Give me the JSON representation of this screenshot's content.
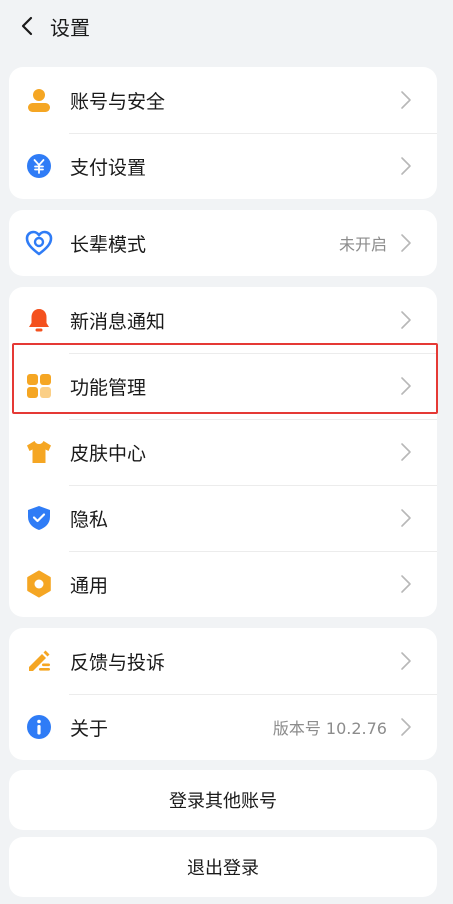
{
  "header": {
    "title": "设置"
  },
  "groups": [
    {
      "items": [
        {
          "label": "账号与安全",
          "icon": "account-icon",
          "value": ""
        },
        {
          "label": "支付设置",
          "icon": "payment-icon",
          "value": ""
        }
      ]
    },
    {
      "items": [
        {
          "label": "长辈模式",
          "icon": "elder-mode-icon",
          "value": "未开启"
        }
      ]
    },
    {
      "items": [
        {
          "label": "新消息通知",
          "icon": "bell-icon",
          "value": ""
        },
        {
          "label": "功能管理",
          "icon": "feature-grid-icon",
          "value": ""
        },
        {
          "label": "皮肤中心",
          "icon": "tshirt-icon",
          "value": ""
        },
        {
          "label": "隐私",
          "icon": "shield-icon",
          "value": ""
        },
        {
          "label": "通用",
          "icon": "gear-icon",
          "value": ""
        }
      ]
    },
    {
      "items": [
        {
          "label": "反馈与投诉",
          "icon": "feedback-icon",
          "value": ""
        },
        {
          "label": "关于",
          "icon": "info-icon",
          "value": "版本号 10.2.76"
        }
      ]
    }
  ],
  "actions": {
    "switch_account": "登录其他账号",
    "logout": "退出登录"
  },
  "colors": {
    "background": "#f1f3f5",
    "orange": "#f5a623",
    "blue": "#2f7cf6",
    "red": "#f4511e",
    "highlight": "#e53935"
  }
}
